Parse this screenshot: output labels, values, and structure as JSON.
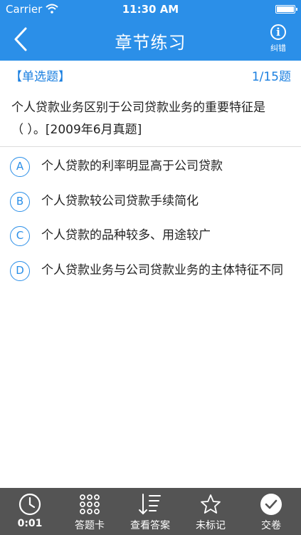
{
  "status_bar": {
    "carrier": "Carrier",
    "time": "11:30 AM"
  },
  "nav": {
    "title": "章节练习",
    "fix_label": "纠错",
    "info_glyph": "i"
  },
  "question": {
    "type": "【单选题】",
    "counter": "1/15题",
    "line1": "个人贷款业务区别于公司贷款业务的重要特征是",
    "line2": "（   ）。[2009年6月真题]"
  },
  "options": [
    {
      "letter": "A",
      "text": "个人贷款的利率明显高于公司贷款"
    },
    {
      "letter": "B",
      "text": "个人贷款较公司贷款手续简化"
    },
    {
      "letter": "C",
      "text": "个人贷款的品种较多、用途较广"
    },
    {
      "letter": "D",
      "text": "个人贷款业务与公司贷款业务的主体特征不同"
    }
  ],
  "toolbar": {
    "timer": "0:01",
    "answer_card": "答题卡",
    "view_answer": "查看答案",
    "mark": "未标记",
    "submit": "交卷"
  },
  "colors": {
    "primary": "#2b8fe8",
    "toolbar": "#545454"
  },
  "icons": [
    "back-chevron-icon",
    "info-icon",
    "clock-icon",
    "grid-icon",
    "sort-list-icon",
    "star-icon",
    "check-circle-icon"
  ]
}
